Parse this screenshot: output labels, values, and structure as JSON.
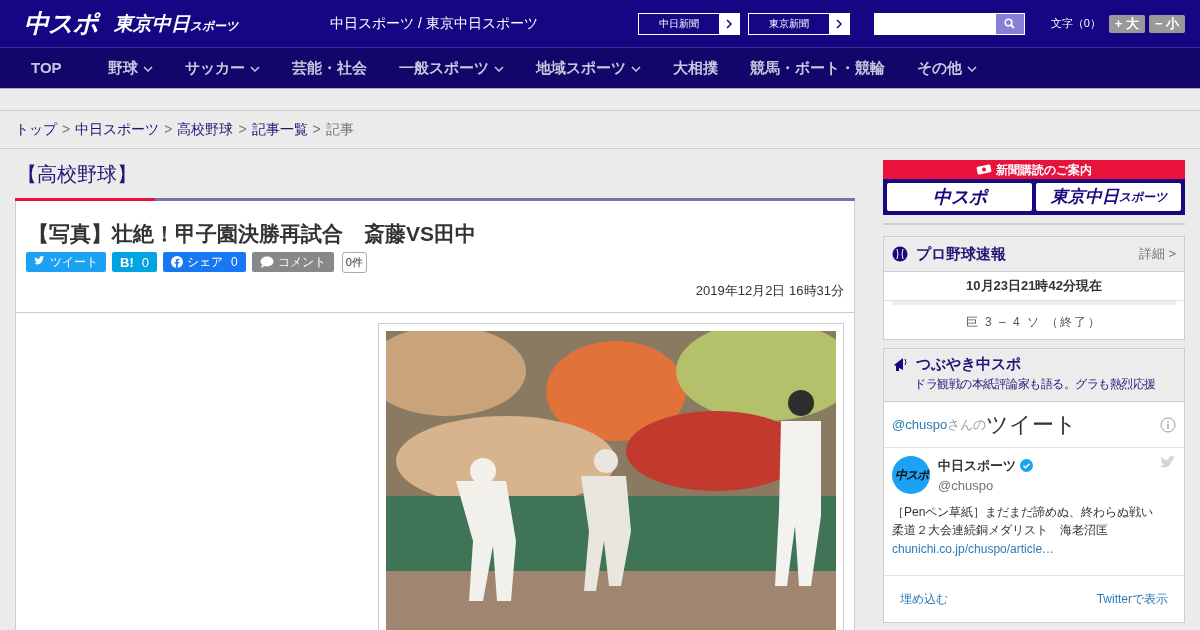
{
  "header": {
    "logo": "中スポ",
    "logo2": "東京中日",
    "logo2_small": "スポーツ",
    "site_title": "中日スポーツ / 東京中日スポーツ",
    "paper_links": [
      "中日新聞",
      "東京新聞"
    ],
    "text_size_label": "文字（0）",
    "text_size_buttons": [
      "+ 大",
      "− 小"
    ]
  },
  "nav": [
    {
      "label": "TOP",
      "dropdown": false
    },
    {
      "label": "野球",
      "dropdown": true
    },
    {
      "label": "サッカー",
      "dropdown": true
    },
    {
      "label": "芸能・社会",
      "dropdown": false
    },
    {
      "label": "一般スポーツ",
      "dropdown": true
    },
    {
      "label": "地域スポーツ",
      "dropdown": true
    },
    {
      "label": "大相撲",
      "dropdown": false
    },
    {
      "label": "競馬・ボート・競輪",
      "dropdown": false
    },
    {
      "label": "その他",
      "dropdown": true
    }
  ],
  "breadcrumb_separator": ">",
  "breadcrumb": [
    {
      "label": "トップ",
      "link": true
    },
    {
      "label": "中日スポーツ",
      "link": true
    },
    {
      "label": "高校野球",
      "link": true
    },
    {
      "label": "記事一覧",
      "link": true
    },
    {
      "label": "記事",
      "link": false
    }
  ],
  "category": "【高校野球】",
  "article": {
    "title": "【写真】壮絶！甲子園決勝再試合　斎藤VS田中",
    "share": [
      {
        "kind": "twitter",
        "label": "ツイート"
      },
      {
        "kind": "hatena",
        "label": "B!",
        "count": "0"
      },
      {
        "kind": "facebook",
        "label": "シェア",
        "count": "0"
      },
      {
        "kind": "comment",
        "label": "コメント",
        "count": "0件"
      }
    ],
    "date": "2019年12月2日 16時31分"
  },
  "sidebar": {
    "subscribe": {
      "title": "新聞購読のご案内",
      "logo": "中スポ",
      "logo2": "東京中日",
      "logo2_small": "スポーツ"
    },
    "scores": {
      "title": "プロ野球速報",
      "more": "詳細 >",
      "updated": "10月23日21時42分現在",
      "games": [
        "巨 3 – 4 ソ （終了）"
      ]
    },
    "tweets": {
      "title": "つぶやき中スポ",
      "subtitle": "ドラ観戦の本紙評論家も語る。グラも熱烈応援",
      "handle": "@chuspo",
      "handle_suffix": "さんの",
      "heading": "ツイート",
      "tweet": {
        "name": "中日スポーツ",
        "verified": true,
        "avatar_text": "中スポ",
        "user": "@chuspo",
        "text": [
          "［Penペン草紙］まだまだ諦めぬ、終わらぬ戦い",
          "柔道２大会連続銅メダリスト　海老沼匡"
        ],
        "link": "chunichi.co.jp/chuspo/article…"
      },
      "embed": "埋め込む",
      "view": "Twitterで表示"
    }
  }
}
